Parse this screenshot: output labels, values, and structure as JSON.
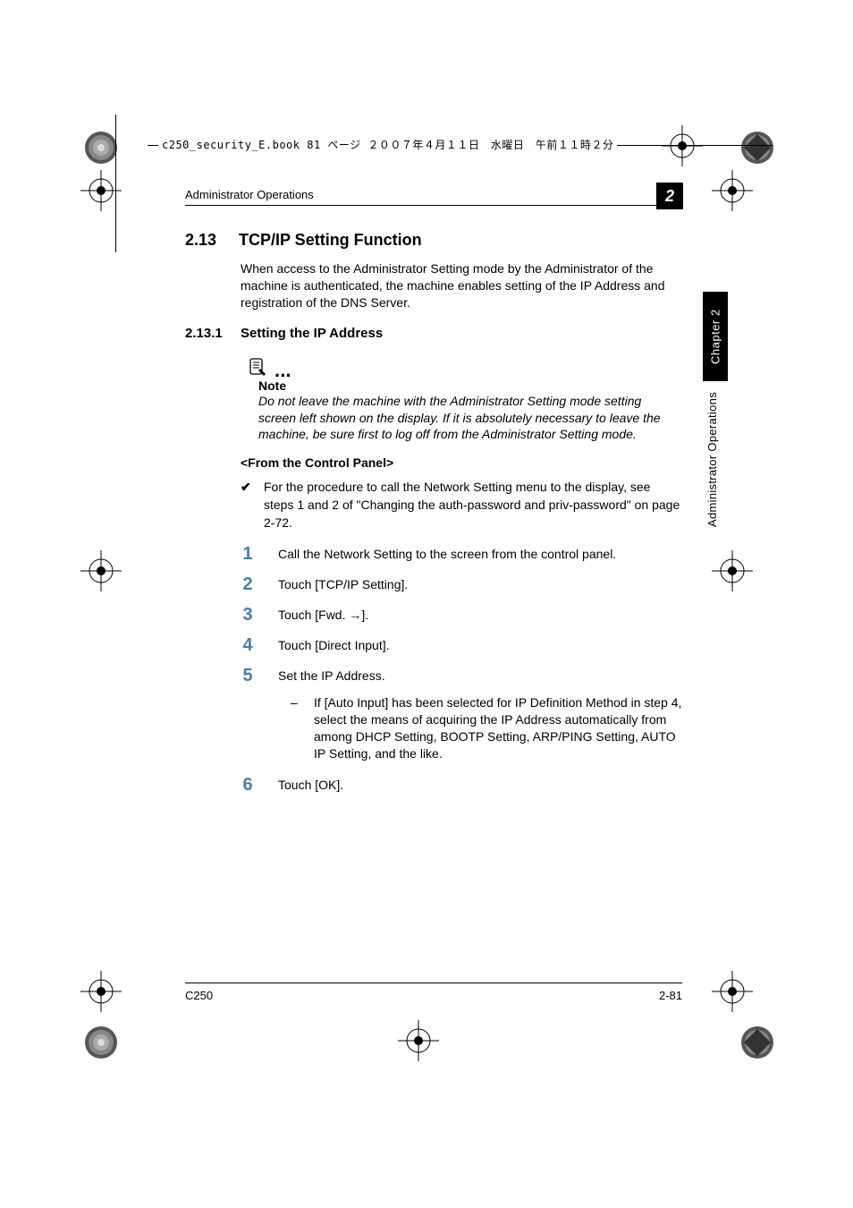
{
  "bookmark_bar": "c250_security_E.book  81 ページ  ２００７年４月１１日　水曜日　午前１１時２分",
  "running_head": "Administrator Operations",
  "chapter_badge": "2",
  "side_tab_chapter": "Chapter 2",
  "side_tab_title": "Administrator Operations",
  "section": {
    "number": "2.13",
    "title": "TCP/IP Setting Function",
    "intro": "When access to the Administrator Setting mode by the Administrator of the machine is authenticated, the machine enables setting of the IP Address and registration of the DNS Server."
  },
  "subsection": {
    "number": "2.13.1",
    "title": "Setting the IP Address"
  },
  "note": {
    "label": "Note",
    "body": "Do not leave the machine with the Administrator Setting mode setting screen left shown on the display. If it is absolutely necessary to leave the machine, be sure first to log off from the Administrator Setting mode."
  },
  "panel_head": "<From the Control Panel>",
  "check_item": "For the procedure to call the Network Setting menu to the display, see steps 1 and 2 of \"Changing the auth-password and priv-password\" on page 2-72.",
  "steps": {
    "s1": {
      "n": "1",
      "t": "Call the Network Setting to the screen from the control panel."
    },
    "s2": {
      "n": "2",
      "t": "Touch [TCP/IP Setting]."
    },
    "s3": {
      "n": "3",
      "t": "Touch [Fwd. →]."
    },
    "s4": {
      "n": "4",
      "t": "Touch [Direct Input]."
    },
    "s5": {
      "n": "5",
      "t": "Set the IP Address."
    },
    "s5_sub": "If [Auto Input] has been selected for IP Definition Method in step 4, select the means of acquiring the IP Address automatically from among DHCP Setting, BOOTP Setting, ARP/PING Setting, AUTO IP Setting, and the like.",
    "s6": {
      "n": "6",
      "t": "Touch [OK]."
    }
  },
  "footer": {
    "model": "C250",
    "page": "2-81"
  }
}
